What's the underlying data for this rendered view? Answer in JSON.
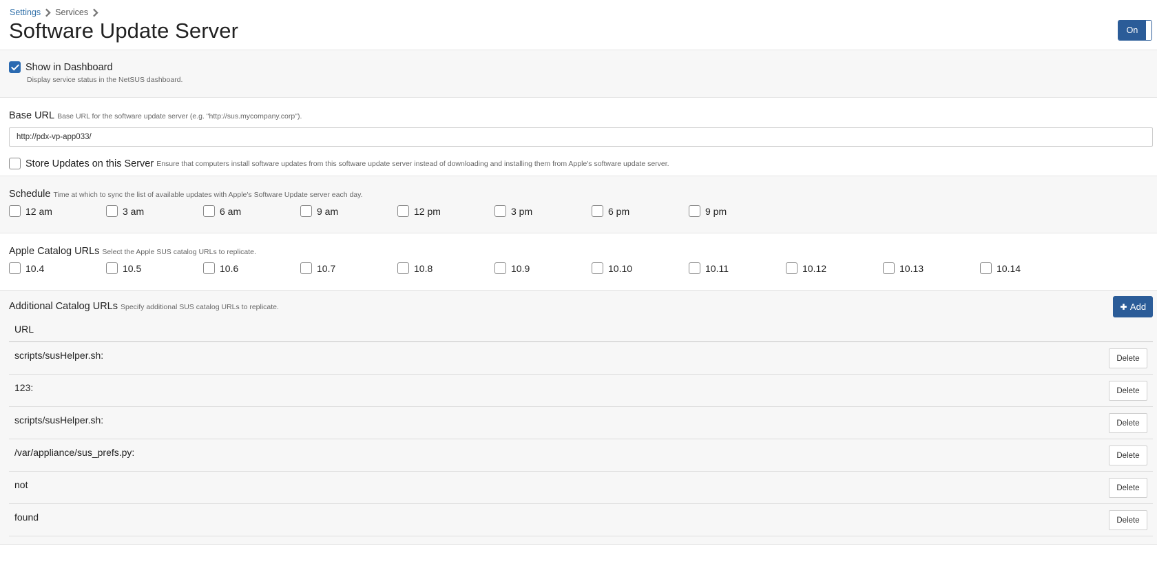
{
  "breadcrumb": {
    "settings": "Settings",
    "services": "Services"
  },
  "page": {
    "title": "Software Update Server",
    "toggle_label": "On"
  },
  "dashboard": {
    "label": "Show in Dashboard",
    "help": "Display service status in the NetSUS dashboard.",
    "checked": true
  },
  "base_url": {
    "label": "Base URL",
    "help": "Base URL for the software update server (e.g. \"http://sus.mycompany.corp\").",
    "value": "http://pdx-vp-app033/"
  },
  "store_updates": {
    "label": "Store Updates on this Server",
    "help": "Ensure that computers install software updates from this software update server instead of downloading and installing them from Apple's software update server.",
    "checked": false
  },
  "schedule": {
    "label": "Schedule",
    "help": "Time at which to sync the list of available updates with Apple's Software Update server each day.",
    "options": [
      "12 am",
      "3 am",
      "6 am",
      "9 am",
      "12 pm",
      "3 pm",
      "6 pm",
      "9 pm"
    ]
  },
  "catalogs": {
    "label": "Apple Catalog URLs",
    "help": "Select the Apple SUS catalog URLs to replicate.",
    "options": [
      "10.4",
      "10.5",
      "10.6",
      "10.7",
      "10.8",
      "10.9",
      "10.10",
      "10.11",
      "10.12",
      "10.13",
      "10.14"
    ]
  },
  "additional": {
    "label": "Additional Catalog URLs",
    "help": "Specify additional SUS catalog URLs to replicate.",
    "add_label": "Add",
    "column_header": "URL",
    "delete_label": "Delete",
    "rows": [
      "scripts/susHelper.sh:",
      "123:",
      "scripts/susHelper.sh:",
      "/var/appliance/sus_prefs.py:",
      "not",
      "found"
    ]
  },
  "colors": {
    "accent": "#2b5c98",
    "link": "#2f6fa8",
    "section_gray": "#f7f7f7"
  },
  "icons": {
    "breadcrumb_separator": "chevron-right-icon",
    "add": "plus-icon",
    "checked": "checkmark-icon"
  }
}
